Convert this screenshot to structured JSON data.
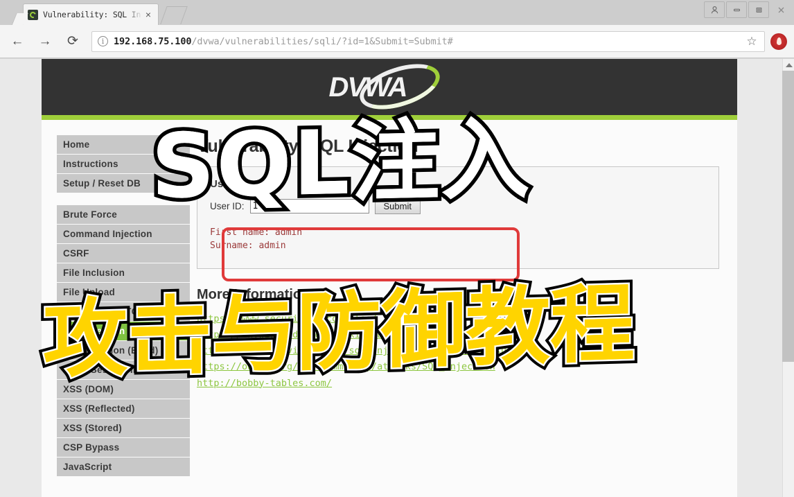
{
  "browser": {
    "tab": {
      "title": "Vulnerability: SQL In",
      "close_label": "×",
      "favicon_name": "dvwa-favicon"
    },
    "new_tab_label": "",
    "nav": {
      "back_label": "←",
      "forward_label": "→",
      "reload_label": "⟳"
    },
    "omnibox": {
      "info_label": "i",
      "url_host": "192.168.75.100",
      "url_path": "/dvwa/vulnerabilities/sqli/?id=1&Submit=Submit#",
      "star_label": "☆"
    },
    "window_controls": {
      "profile_label": "profile-icon",
      "minimize_label": "minimize-icon",
      "maximize_label": "maximize-icon",
      "close_label": "×"
    },
    "extension_label": "extension-icon"
  },
  "dvwa": {
    "logo_text": "DVWA",
    "sidebar": {
      "groups": [
        {
          "items": [
            {
              "label": "Home",
              "active": false
            },
            {
              "label": "Instructions",
              "active": false
            },
            {
              "label": "Setup / Reset DB",
              "active": false
            }
          ]
        },
        {
          "items": [
            {
              "label": "Brute Force",
              "active": false
            },
            {
              "label": "Command Injection",
              "active": false
            },
            {
              "label": "CSRF",
              "active": false
            },
            {
              "label": "File Inclusion",
              "active": false
            },
            {
              "label": "File Upload",
              "active": false
            },
            {
              "label": "Insecure CAPTCHA",
              "active": false
            },
            {
              "label": "SQL Injection",
              "active": true
            },
            {
              "label": "SQL Injection (Blind)",
              "active": false
            },
            {
              "label": "Weak Session IDs",
              "active": false
            },
            {
              "label": "XSS (DOM)",
              "active": false
            },
            {
              "label": "XSS (Reflected)",
              "active": false
            },
            {
              "label": "XSS (Stored)",
              "active": false
            },
            {
              "label": "CSP Bypass",
              "active": false
            },
            {
              "label": "JavaScript",
              "active": false
            }
          ]
        }
      ]
    },
    "content": {
      "page_title": "Vulnerability: SQL Injection",
      "panel_title": "User ID:",
      "form": {
        "label": "User ID:",
        "value": "1'",
        "placeholder": "",
        "submit_label": "Submit"
      },
      "result_line1": "First name: admin",
      "result_line2": "Surname: admin",
      "more_info_title": "More Information",
      "links": [
        "https://www.securifera.com/blog/",
        "https://en.wikipedia.org/wiki/SQL_injection",
        "http://ferruh.mavituna.com/sql-injection-cheatsheet-oku/",
        "https://owasp.org/www-community/attacks/SQL_Injection",
        "http://bobby-tables.com/"
      ]
    }
  },
  "overlay": {
    "title_top": "SQL注入",
    "title_bottom": "攻击与防御教程"
  },
  "colors": {
    "dvwa_green": "#9fcf3a",
    "active_green": "#7fc241",
    "annotation_red": "#e03a3a",
    "caption_yellow": "#ffd400",
    "header_dark": "#333333"
  }
}
